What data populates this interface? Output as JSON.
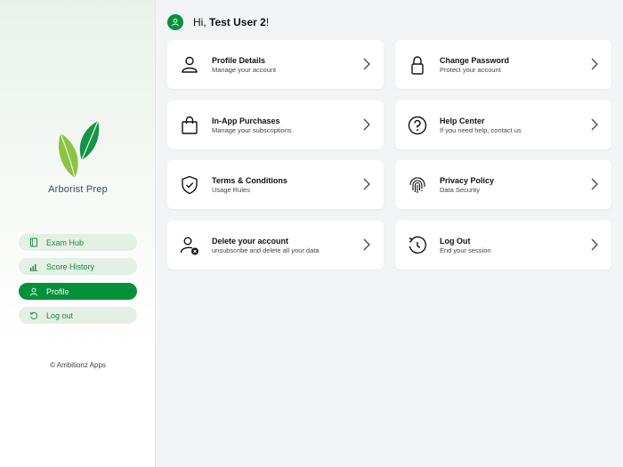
{
  "app": {
    "name": "Arborist Prep",
    "copyright": "© Ambitionz Apps"
  },
  "colors": {
    "accent": "#05913c",
    "accent_light": "#e4efe5"
  },
  "nav": [
    {
      "label": "Exam Hub",
      "icon": "book-icon",
      "active": false
    },
    {
      "label": "Score History",
      "icon": "bar-chart-icon",
      "active": false
    },
    {
      "label": "Profile",
      "icon": "user-icon",
      "active": true
    },
    {
      "label": "Log out",
      "icon": "refresh-icon",
      "active": false
    }
  ],
  "header": {
    "greeting_prefix": "Hi, ",
    "user_name": "Test User 2",
    "greeting_suffix": "!"
  },
  "cards": [
    {
      "title": "Profile Details",
      "subtitle": "Manage your account",
      "icon": "user-icon"
    },
    {
      "title": "Change Password",
      "subtitle": "Protect your account",
      "icon": "lock-icon"
    },
    {
      "title": "In-App Purchases",
      "subtitle": "Manage your subscriptions",
      "icon": "shopping-bag-icon"
    },
    {
      "title": "Help Center",
      "subtitle": "If you need help, contact us",
      "icon": "help-icon"
    },
    {
      "title": "Terms & Conditions",
      "subtitle": "Usage Rules",
      "icon": "shield-check-icon"
    },
    {
      "title": "Privacy Policy",
      "subtitle": "Data Security",
      "icon": "fingerprint-icon"
    },
    {
      "title": "Delete your account",
      "subtitle": "unsubscribe and delete all your data",
      "icon": "user-remove-icon"
    },
    {
      "title": "Log Out",
      "subtitle": "End your session",
      "icon": "logout-icon"
    }
  ]
}
